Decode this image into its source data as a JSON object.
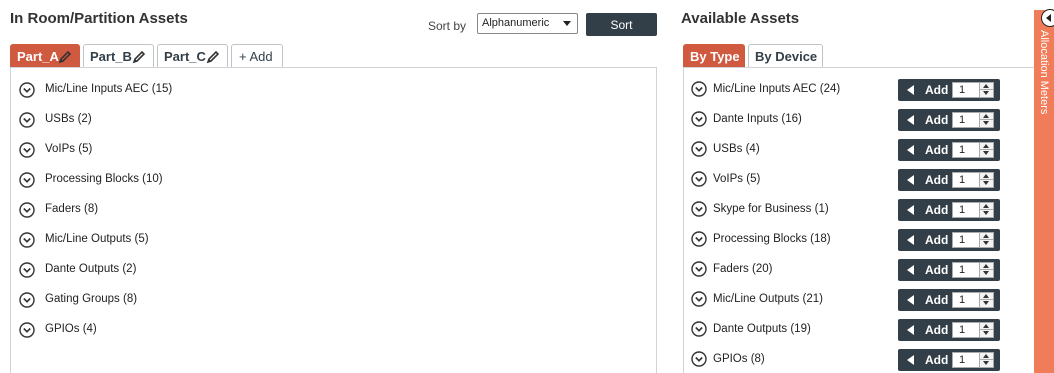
{
  "left_panel": {
    "title": "In Room/Partition Assets",
    "sort_label": "Sort by",
    "sort_value": "Alphanumeric",
    "sort_button": "Sort",
    "tabs": [
      {
        "label": "Part_A",
        "active": true
      },
      {
        "label": "Part_B",
        "active": false
      },
      {
        "label": "Part_C",
        "active": false
      }
    ],
    "add_tab": "+ Add",
    "items": [
      {
        "label": "Mic/Line Inputs AEC (15)"
      },
      {
        "label": "USBs (2)"
      },
      {
        "label": "VoIPs (5)"
      },
      {
        "label": "Processing Blocks (10)"
      },
      {
        "label": "Faders (8)"
      },
      {
        "label": "Mic/Line Outputs (5)"
      },
      {
        "label": "Dante Outputs (2)"
      },
      {
        "label": "Gating Groups (8)"
      },
      {
        "label": "GPIOs (4)"
      }
    ]
  },
  "right_panel": {
    "title": "Available Assets",
    "tabs": [
      {
        "label": "By Type",
        "active": true
      },
      {
        "label": "By Device",
        "active": false
      }
    ],
    "add_label": "Add",
    "items": [
      {
        "label": "Mic/Line Inputs AEC (24)",
        "qty": "1"
      },
      {
        "label": "Dante Inputs (16)",
        "qty": "1"
      },
      {
        "label": "USBs (4)",
        "qty": "1"
      },
      {
        "label": "VoIPs (5)",
        "qty": "1"
      },
      {
        "label": "Skype for Business (1)",
        "qty": "1"
      },
      {
        "label": "Processing Blocks (18)",
        "qty": "1"
      },
      {
        "label": "Faders (20)",
        "qty": "1"
      },
      {
        "label": "Mic/Line Outputs (21)",
        "qty": "1"
      },
      {
        "label": "Dante Outputs (19)",
        "qty": "1"
      },
      {
        "label": "GPIOs (8)",
        "qty": "1"
      }
    ]
  },
  "side_strip": {
    "label": "Allocation Meters",
    "color": "#f07c5a"
  },
  "colors": {
    "accent": "#d05a3f",
    "dark": "#333f48"
  }
}
